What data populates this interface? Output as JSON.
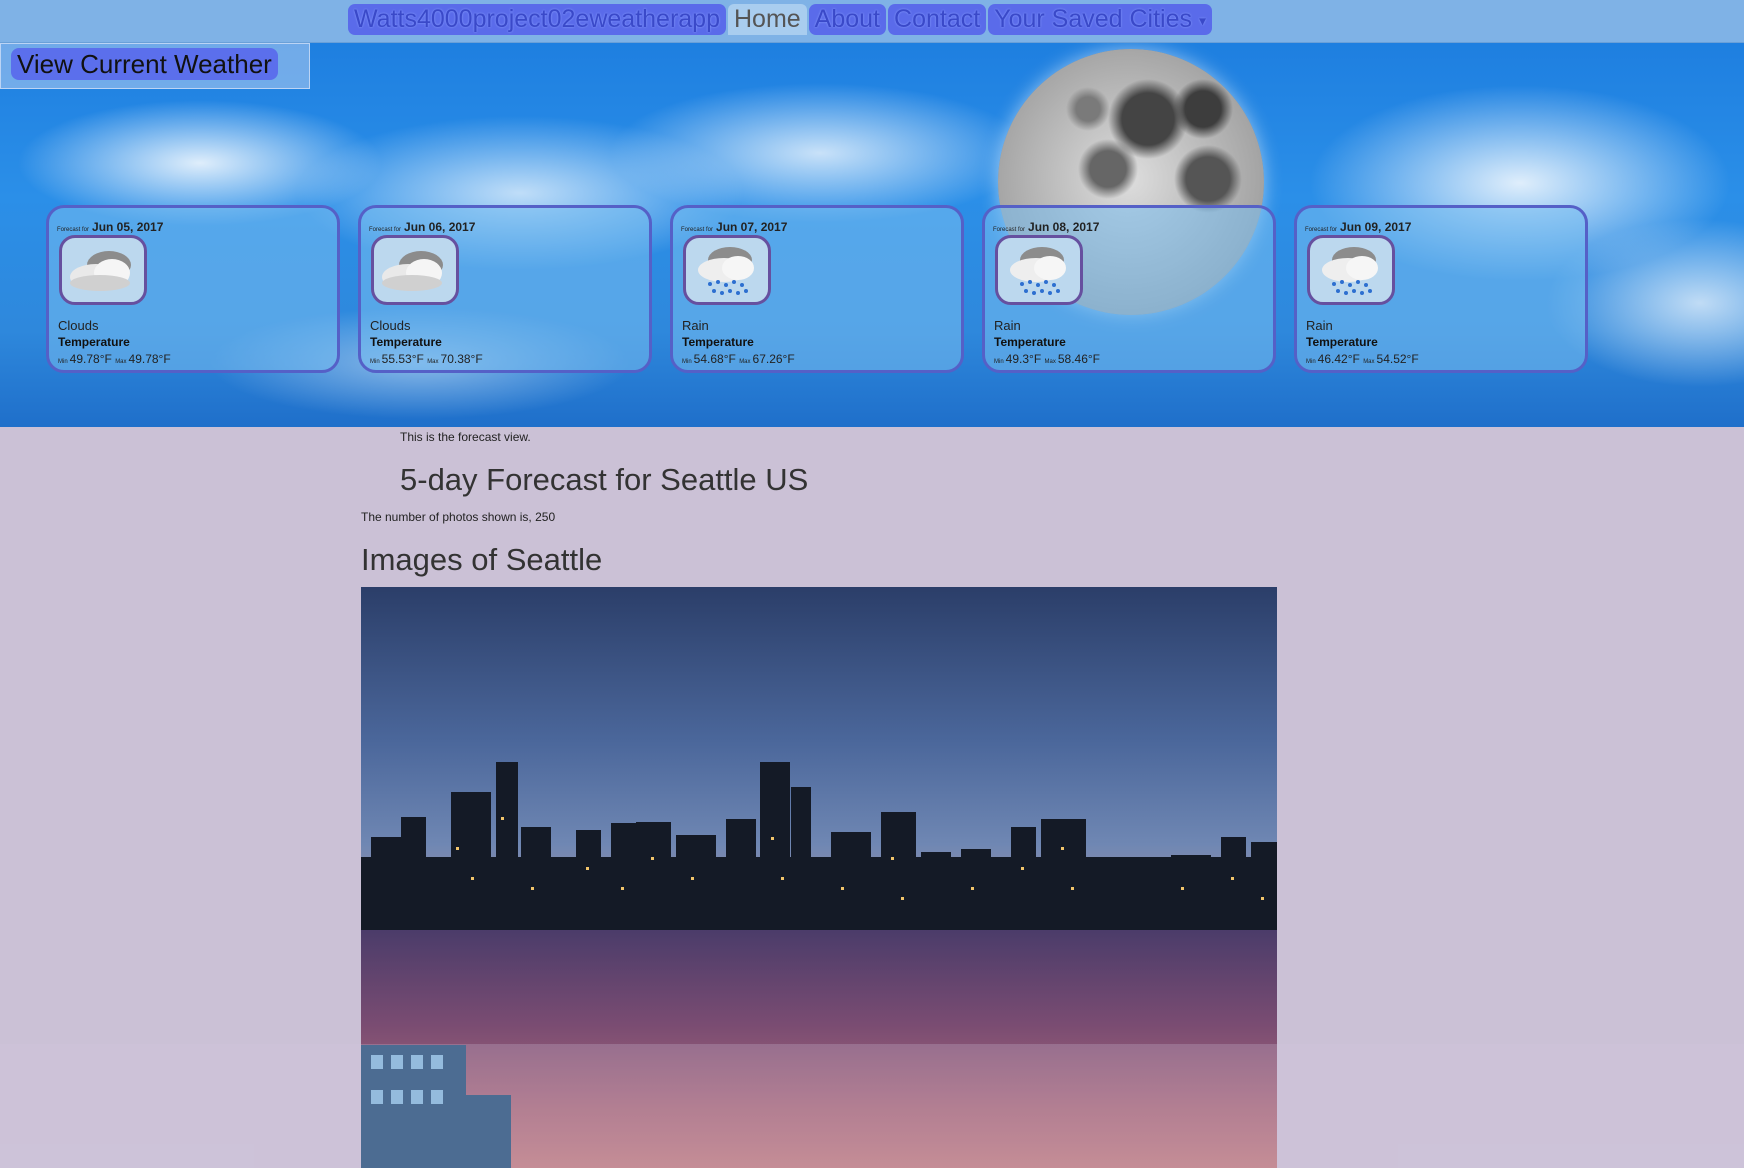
{
  "nav": {
    "brand": "Watts4000project02eweatherapp",
    "items": [
      {
        "label": "Home",
        "active": true
      },
      {
        "label": "About",
        "active": false
      },
      {
        "label": "Contact",
        "active": false
      },
      {
        "label": "Your Saved Cities",
        "active": false
      }
    ],
    "dropdown_caret": "▾"
  },
  "hero": {
    "current_weather_button": "View Current Weather"
  },
  "forecast": [
    {
      "prefix": "Forecast for",
      "date": "Jun 05, 2017",
      "icon": "clouds-icon",
      "condition": "Clouds",
      "temp_label": "Temperature",
      "min_label": "Min",
      "min": "49.78°F",
      "max_label": "Max",
      "max": "49.78°F"
    },
    {
      "prefix": "Forecast for",
      "date": "Jun 06, 2017",
      "icon": "clouds-icon",
      "condition": "Clouds",
      "temp_label": "Temperature",
      "min_label": "Min",
      "min": "55.53°F",
      "max_label": "Max",
      "max": "70.38°F"
    },
    {
      "prefix": "Forecast for",
      "date": "Jun 07, 2017",
      "icon": "rain-icon",
      "condition": "Rain",
      "temp_label": "Temperature",
      "min_label": "Min",
      "min": "54.68°F",
      "max_label": "Max",
      "max": "67.26°F"
    },
    {
      "prefix": "Forecast for",
      "date": "Jun 08, 2017",
      "icon": "rain-icon",
      "condition": "Rain",
      "temp_label": "Temperature",
      "min_label": "Min",
      "min": "49.3°F",
      "max_label": "Max",
      "max": "58.46°F"
    },
    {
      "prefix": "Forecast for",
      "date": "Jun 09, 2017",
      "icon": "rain-icon",
      "condition": "Rain",
      "temp_label": "Temperature",
      "min_label": "Min",
      "min": "46.42°F",
      "max_label": "Max",
      "max": "54.52°F"
    }
  ],
  "main": {
    "forecast_note": "This is the forecast view.",
    "forecast_heading": "5-day Forecast for Seattle US",
    "photo_count": "The number of photos shown is, 250",
    "images_heading": "Images of Seattle"
  },
  "colors": {
    "nav_bg": "#7fb2e6",
    "nav_item_bg": "#5a6bea",
    "page_bg": "#cbc1d6",
    "card_border": "#5560c7"
  }
}
